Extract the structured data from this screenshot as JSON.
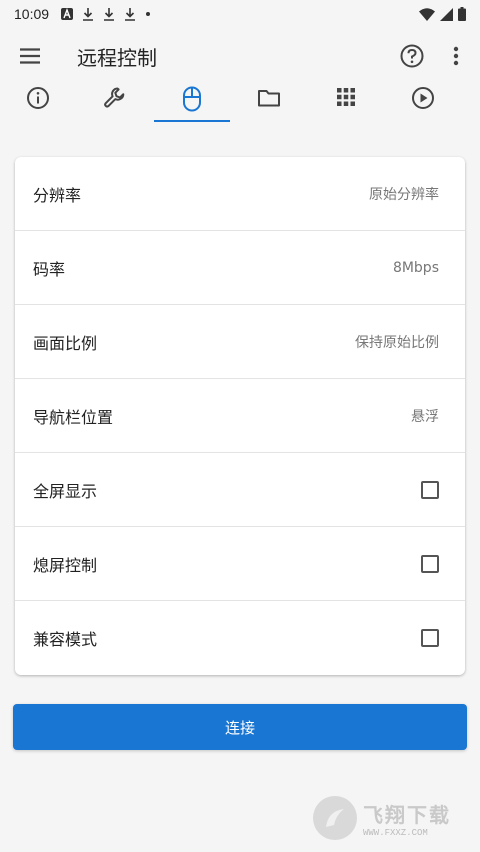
{
  "status_bar": {
    "time": "10:09",
    "left_icons": [
      "a-badge-icon",
      "download-icon",
      "download-icon",
      "download-icon",
      "dot-icon"
    ],
    "right_icons": [
      "wifi-icon",
      "signal-icon",
      "battery-icon"
    ]
  },
  "toolbar": {
    "title": "远程控制",
    "icons": [
      "menu-icon",
      "help-icon",
      "more-vert-icon"
    ]
  },
  "tabs": [
    {
      "icon": "info-icon",
      "active": false
    },
    {
      "icon": "wrench-icon",
      "active": false
    },
    {
      "icon": "mouse-icon",
      "active": true
    },
    {
      "icon": "folder-icon",
      "active": false
    },
    {
      "icon": "apps-grid-icon",
      "active": false
    },
    {
      "icon": "play-circle-icon",
      "active": false
    }
  ],
  "settings": [
    {
      "label": "分辨率",
      "value": "原始分辨率"
    },
    {
      "label": "码率",
      "value": "8Mbps"
    },
    {
      "label": "画面比例",
      "value": "保持原始比例"
    },
    {
      "label": "导航栏位置",
      "value": "悬浮"
    },
    {
      "label": "全屏显示",
      "checked": false
    },
    {
      "label": "熄屏控制",
      "checked": false
    },
    {
      "label": "兼容模式",
      "checked": false
    }
  ],
  "connect_button": {
    "label": "连接"
  },
  "watermark": {
    "brand": "飞翔下载",
    "url": "WWW.FXXZ.COM"
  },
  "colors": {
    "accent": "#1976d2",
    "background": "#f5f5f5",
    "card": "#ffffff",
    "icon": "#444444"
  }
}
